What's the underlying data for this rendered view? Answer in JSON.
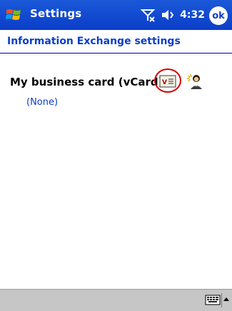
{
  "title_bar": {
    "app_title": "Settings",
    "time": "4:32",
    "ok_label": "ok",
    "icons": [
      "windows-start-icon",
      "signal-off-icon",
      "volume-icon"
    ]
  },
  "header": {
    "title": "Information Exchange settings"
  },
  "main": {
    "business_card_label": "My business card (vCard)",
    "business_card_value": "(None)",
    "icons": [
      "vcard-icon",
      "contact-wizard-icon"
    ]
  },
  "menu_bar": {
    "icons": [
      "keyboard-icon",
      "sip-arrow-up-icon"
    ]
  },
  "colors": {
    "title_bar": "#0b3ec9",
    "header_text": "#0b3ec9",
    "highlight_circle": "#d40000",
    "menu_bar": "#c6c6c6"
  }
}
